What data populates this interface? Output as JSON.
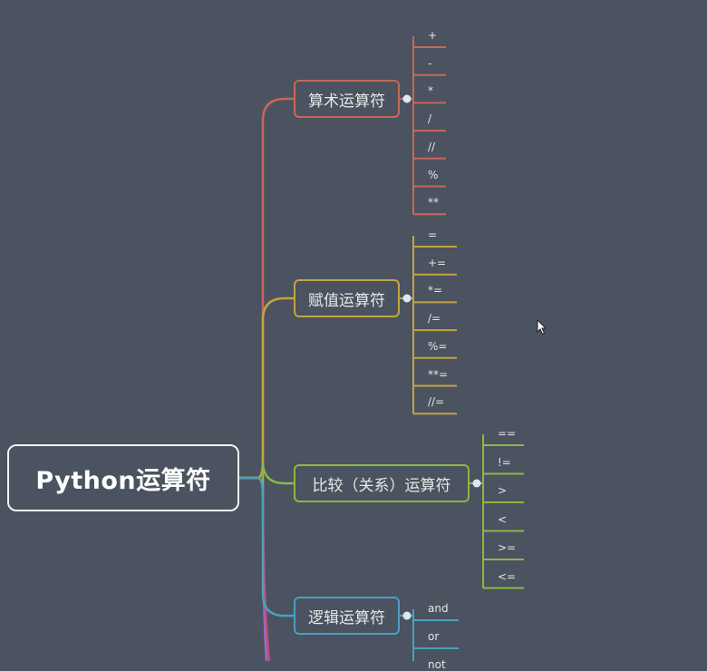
{
  "root": {
    "label": "Python运算符"
  },
  "branches": [
    {
      "id": "arithmetic",
      "label": "算术运算符",
      "color": "#c8675a",
      "items": [
        "+",
        "-",
        "*",
        "/",
        "//",
        "%",
        "**"
      ]
    },
    {
      "id": "assignment",
      "label": "赋值运算符",
      "color": "#c2a442",
      "items": [
        "=",
        "+=",
        "*=",
        "/=",
        "%=",
        "**=",
        "//="
      ]
    },
    {
      "id": "comparison",
      "label": "比较（关系）运算符",
      "color": "#8db646",
      "items": [
        "==",
        "!=",
        ">",
        "<",
        ">=",
        "<="
      ]
    },
    {
      "id": "logical",
      "label": "逻辑运算符",
      "color": "#4aa0c2",
      "items": [
        "and",
        "or",
        "not"
      ]
    }
  ],
  "colors": {
    "background": "#4a535f",
    "root_border": "#f2f2f2",
    "trunk_extra": [
      "#9a6ad0",
      "#c0507a"
    ]
  },
  "icons": {
    "cursor": "arrow-cursor-icon"
  }
}
